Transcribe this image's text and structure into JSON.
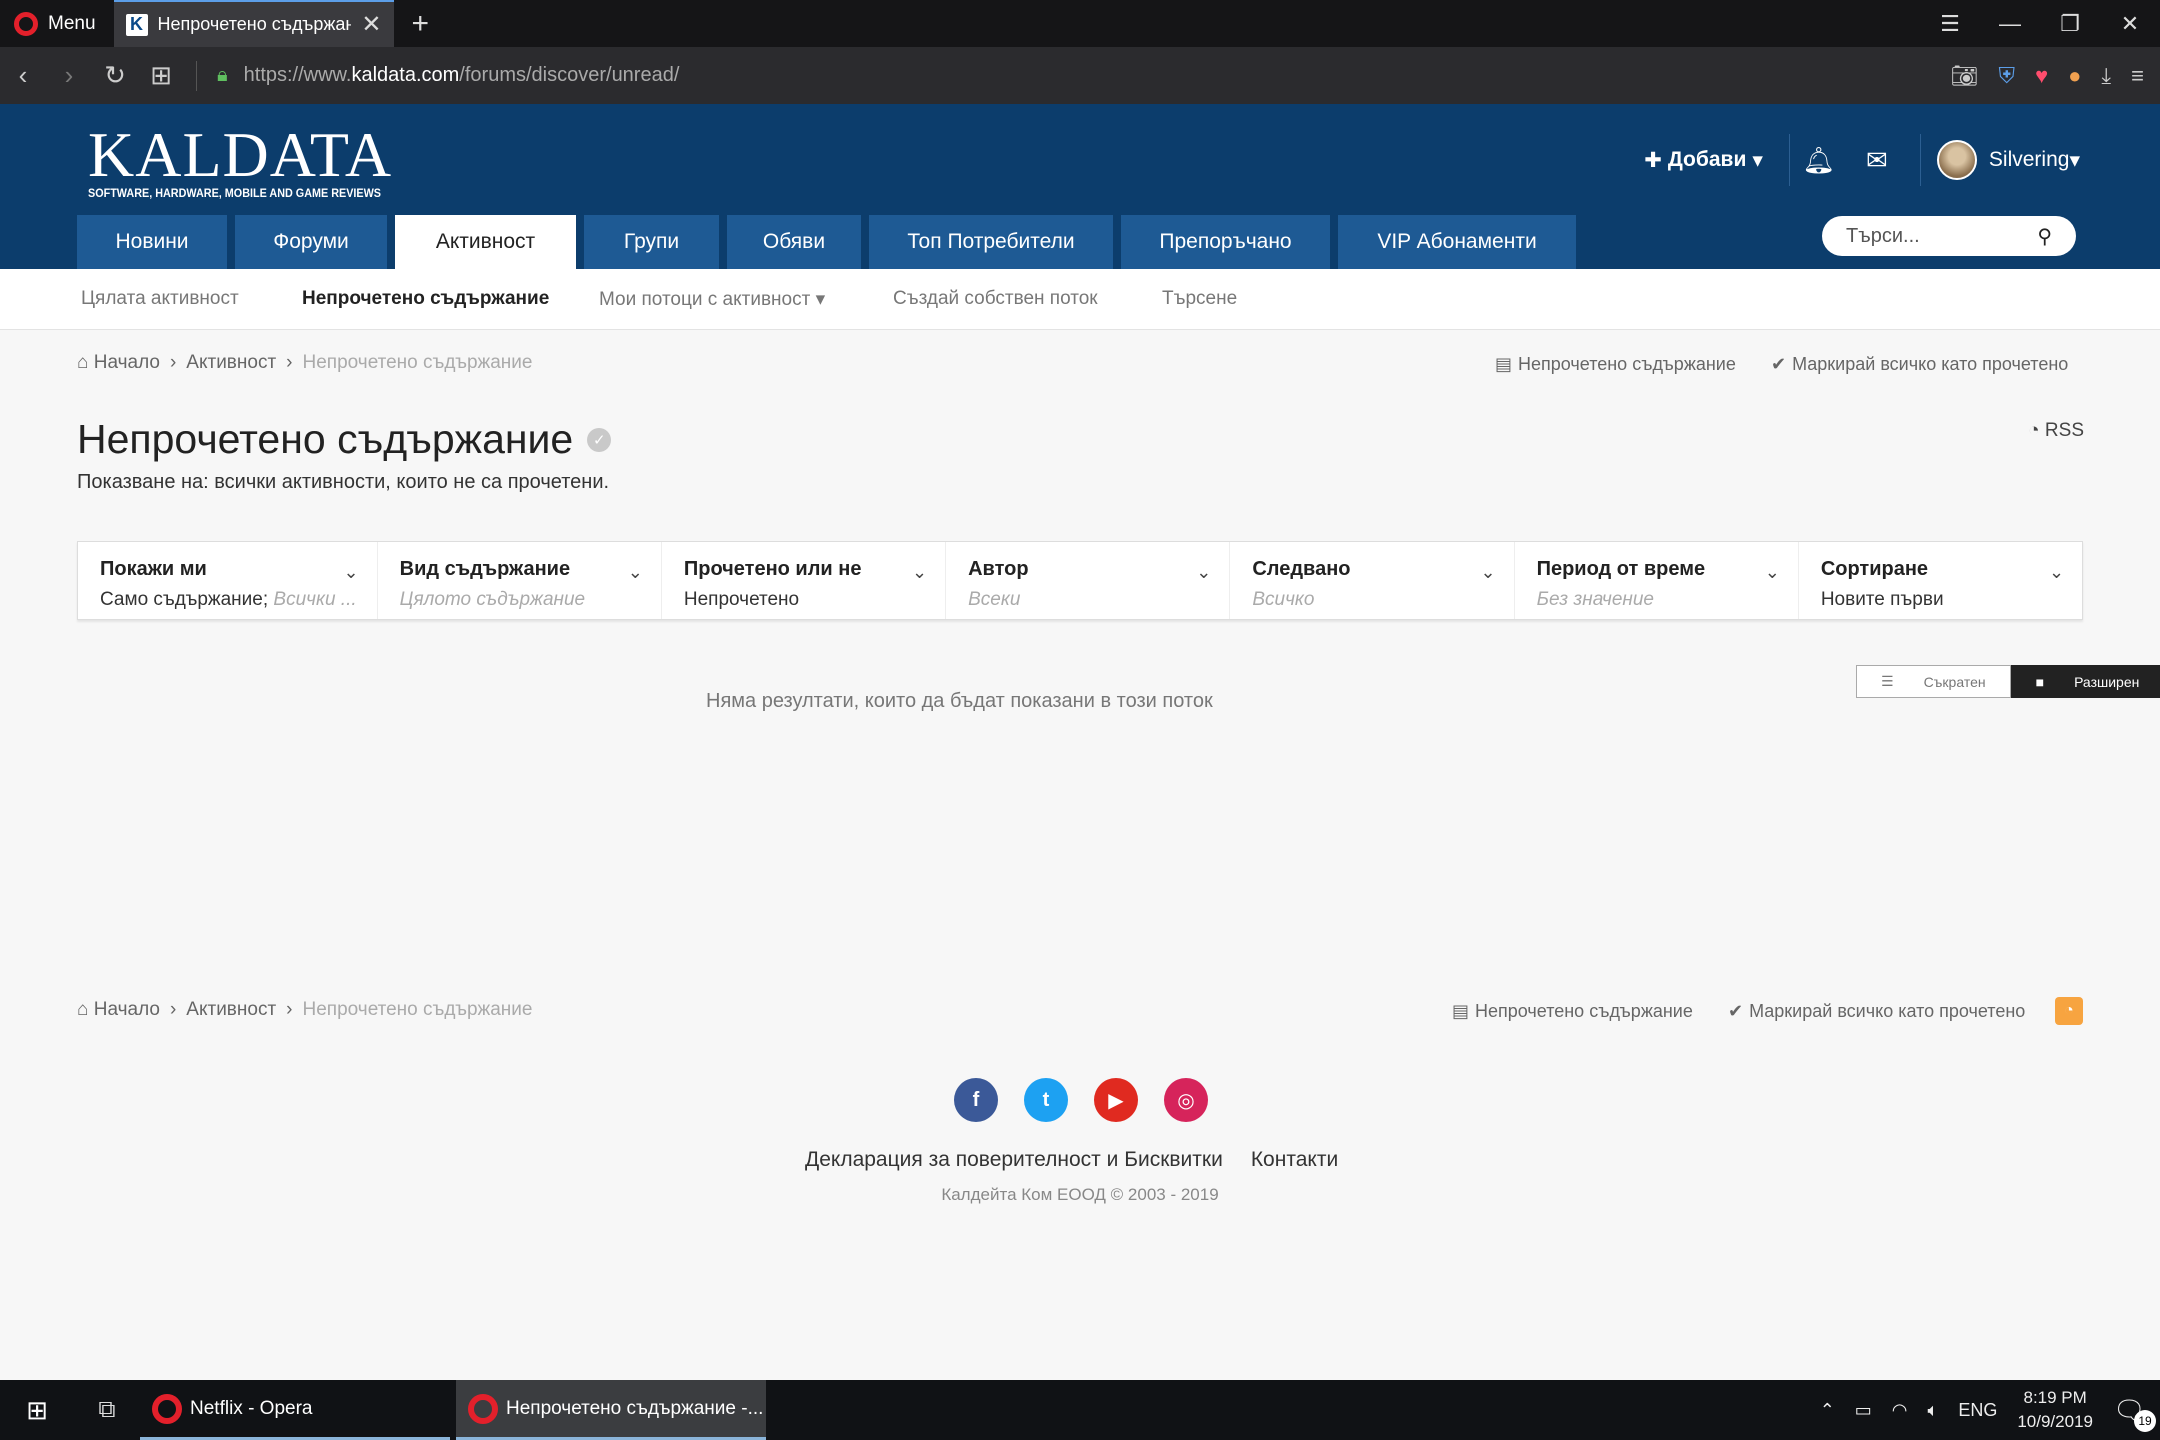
{
  "browser": {
    "menu_label": "Menu",
    "tab_title": "Непрочетено съдържание",
    "tab_favicon": "K",
    "url_prefix": "https://www.",
    "url_domain": "kaldata.com",
    "url_path": "/forums/discover/unread/"
  },
  "site": {
    "logo_main": "KALDATA",
    "logo_sub": "SOFTWARE, HARDWARE, MOBILE AND GAME REVIEWS",
    "add_label": "Добави",
    "username": "Silvering",
    "search_placeholder": "Търси...",
    "nav_tabs": [
      {
        "label": "Новини"
      },
      {
        "label": "Форуми"
      },
      {
        "label": "Активност"
      },
      {
        "label": "Групи"
      },
      {
        "label": "Обяви"
      },
      {
        "label": "Топ Потребители"
      },
      {
        "label": "Препоръчано"
      },
      {
        "label": "VIP Абонаменти"
      }
    ],
    "subnav": [
      {
        "label": "Цялата активност"
      },
      {
        "label": "Непрочетено съдържание"
      },
      {
        "label": "Мои потоци с активност"
      },
      {
        "label": "Създай собствен поток"
      },
      {
        "label": "Търсене"
      }
    ]
  },
  "breadcrumb": {
    "home": "Начало",
    "section": "Активност",
    "current": "Непрочетено съдържание",
    "unread_link": "Непрочетено съдържание",
    "mark_read": "Маркирай всичко като прочетено"
  },
  "page": {
    "title": "Непрочетено съдържание",
    "description": "Показване на: всички активности, които не са прочетени.",
    "rss": "RSS",
    "no_results": "Няма резултати, които да бъдат показани в този поток",
    "view_compact": "Съкратен",
    "view_expanded": "Разширен"
  },
  "filters": [
    {
      "label": "Покажи ми",
      "value": "Само съдържание;",
      "value_extra": "Всички ..."
    },
    {
      "label": "Вид съдържание",
      "value": "Цялото съдържание"
    },
    {
      "label": "Прочетено или не",
      "value": "Непрочетено"
    },
    {
      "label": "Автор",
      "value": "Всеки"
    },
    {
      "label": "Следвано",
      "value": "Всичко"
    },
    {
      "label": "Период от време",
      "value": "Без значение"
    },
    {
      "label": "Сортиране",
      "value": "Новите първи"
    }
  ],
  "footer": {
    "privacy": "Декларация за поверителност и Бисквитки",
    "contacts": "Контакти",
    "copyright": "Калдейта Ком ЕООД © 2003 - 2019",
    "socials": [
      {
        "name": "facebook",
        "glyph": "f",
        "color": "#3b5998"
      },
      {
        "name": "twitter",
        "glyph": "t",
        "color": "#1da1f2"
      },
      {
        "name": "youtube",
        "glyph": "▶",
        "color": "#e02a20"
      },
      {
        "name": "instagram",
        "glyph": "◎",
        "color": "#d6245b"
      }
    ]
  },
  "taskbar": {
    "app1": "Netflix - Opera",
    "app2": "Непрочетено съдържание -...",
    "lang": "ENG",
    "time": "8:19 PM",
    "date": "10/9/2019",
    "notifications": "19"
  },
  "colors": {
    "header_bg": "#0c3d6c",
    "nav_tab_bg": "#1e5a94",
    "rss_orange": "#f7a440"
  }
}
